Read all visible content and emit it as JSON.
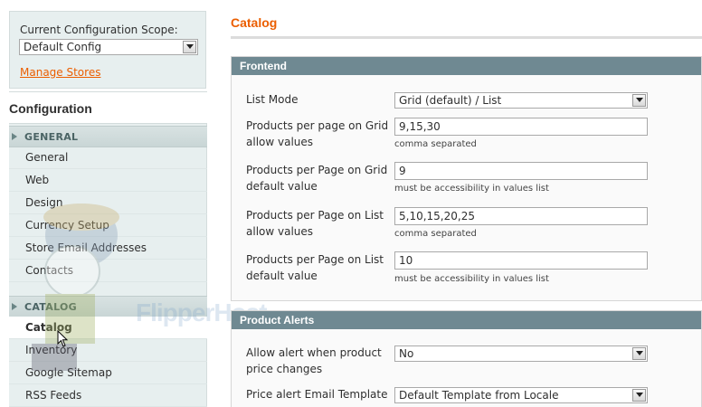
{
  "sidebar": {
    "scope_label": "Current Configuration Scope:",
    "scope_value": "Default Config",
    "manage_stores": "Manage Stores",
    "config_title": "Configuration",
    "groups": [
      {
        "label": "GENERAL",
        "items": [
          "General",
          "Web",
          "Design",
          "Currency Setup",
          "Store Email Addresses",
          "Contacts"
        ]
      },
      {
        "label": "CATALOG",
        "items": [
          "Catalog",
          "Inventory",
          "Google Sitemap",
          "RSS Feeds"
        ]
      }
    ],
    "active_item": "Catalog"
  },
  "watermark": "FlipperHost",
  "main": {
    "title": "Catalog",
    "frontend": {
      "header": "Frontend",
      "list_mode_label": "List Mode",
      "list_mode_value": "Grid (default) / List",
      "grid_allow_label": "Products per page on Grid allow values",
      "grid_allow_value": "9,15,30",
      "grid_allow_note": "comma separated",
      "grid_default_label": "Products per Page on Grid default value",
      "grid_default_value": "9",
      "grid_default_note": "must be accessibility in values list",
      "list_allow_label": "Products per Page on List allow values",
      "list_allow_value": "5,10,15,20,25",
      "list_allow_note": "comma separated",
      "list_default_label": "Products per Page on List default value",
      "list_default_value": "10",
      "list_default_note": "must be accessibility in values list"
    },
    "alerts": {
      "header": "Product Alerts",
      "allow_label": "Allow alert when product price changes",
      "allow_value": "No",
      "template_label": "Price alert Email Template",
      "template_value": "Default Template from Locale"
    }
  },
  "colors": {
    "accent": "#eb5e00",
    "section_header": "#6f8992",
    "sidebar_bg": "#e7efef"
  }
}
